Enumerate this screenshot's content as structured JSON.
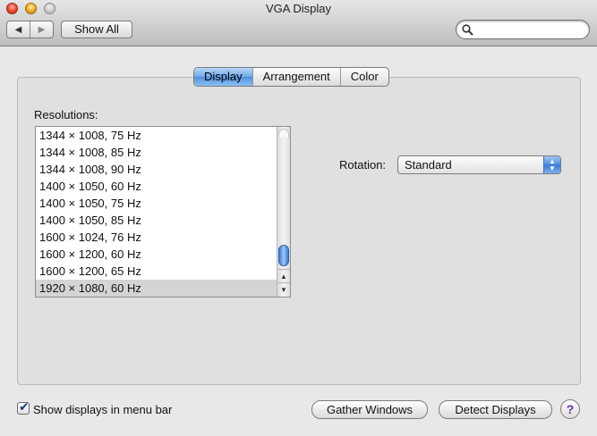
{
  "window": {
    "title": "VGA Display"
  },
  "toolbar": {
    "back_icon": "◀",
    "forward_icon": "▶",
    "show_all_label": "Show All",
    "search_placeholder": ""
  },
  "tabs": [
    {
      "label": "Display",
      "selected": true
    },
    {
      "label": "Arrangement",
      "selected": false
    },
    {
      "label": "Color",
      "selected": false
    }
  ],
  "resolutions": {
    "label": "Resolutions:",
    "items": [
      "1344 × 1008, 75 Hz",
      "1344 × 1008, 85 Hz",
      "1344 × 1008, 90 Hz",
      "1400 × 1050, 60 Hz",
      "1400 × 1050, 75 Hz",
      "1400 × 1050, 85 Hz",
      "1600 × 1024, 76 Hz",
      "1600 × 1200, 60 Hz",
      "1600 × 1200, 65 Hz",
      "1920 × 1080, 60 Hz"
    ],
    "selected_index": 9
  },
  "rotation": {
    "label": "Rotation:",
    "value": "Standard"
  },
  "bottom": {
    "show_in_menu_bar_label": "Show displays in menu bar",
    "show_in_menu_bar_checked": true,
    "gather_windows_label": "Gather Windows",
    "detect_displays_label": "Detect Displays",
    "help_label": "?"
  },
  "colors": {
    "tab_selected": "#6ea8e9",
    "scroll_thumb": "#3a7bd5",
    "help_icon": "#6b2fa0"
  }
}
